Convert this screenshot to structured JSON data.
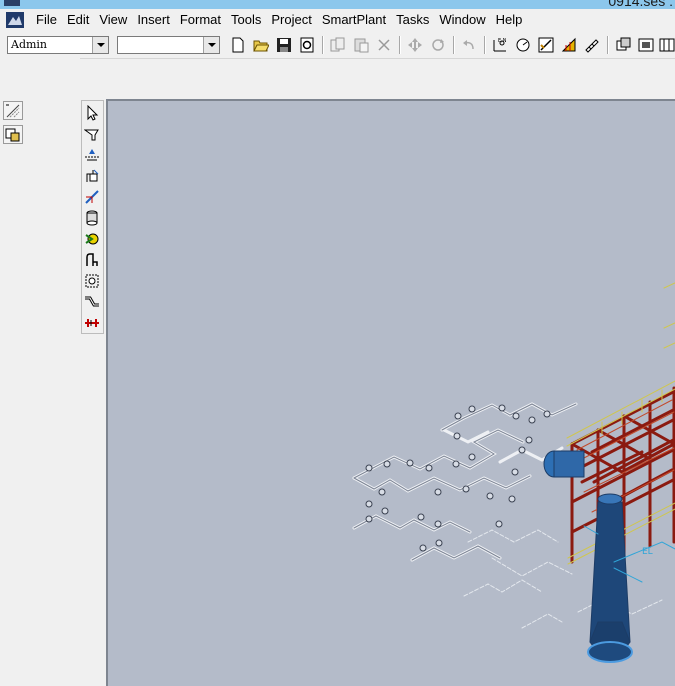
{
  "window": {
    "title_fragment": "0914.ses : "
  },
  "menu": [
    "File",
    "Edit",
    "View",
    "Insert",
    "Format",
    "Tools",
    "Project",
    "SmartPlant",
    "Tasks",
    "Window",
    "Help"
  ],
  "toolbar": {
    "permission_group": {
      "value": "Admin"
    },
    "filter": {
      "value": ""
    },
    "buttons": [
      "new-icon",
      "open-icon",
      "save-icon",
      "refresh-icon",
      "copy-icon",
      "paste-icon",
      "delete-icon",
      "move-icon",
      "rotate-icon",
      "undo-icon",
      "properties-icon",
      "measure-icon",
      "check-icon",
      "insert-note-icon",
      "ruler-icon",
      "view-icon-1",
      "view-icon-2",
      "view-icon-3"
    ]
  },
  "left_dock_tools": [
    "grid-icon",
    "select-set-icon"
  ],
  "palette_tools": [
    "select-icon",
    "route-pipe-icon",
    "insert-component-icon",
    "insert-specialty-icon",
    "connect-icon",
    "insert-tap-icon",
    "insert-split-icon",
    "insert-feature-icon",
    "insert-tag-icon",
    "sloped-pipe-icon",
    "insert-spool-break-icon"
  ],
  "colors": {
    "viewport_bg": "#b4bbc9",
    "structure_red": "#8b1a10",
    "equipment_blue": "#1f4f86",
    "pipe_white": "#e8ebf0"
  }
}
